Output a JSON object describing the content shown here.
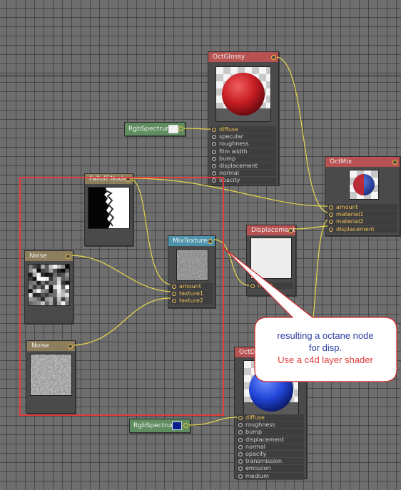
{
  "nodes": {
    "oct_glossy": {
      "title": "OctGlossy",
      "ports": [
        "diffuse",
        "specular",
        "roughness",
        "film width",
        "bump",
        "displacement",
        "normal",
        "opacity"
      ]
    },
    "oct_mix": {
      "title": "OctMix",
      "ports": [
        "amount",
        "material1",
        "material2",
        "displacement"
      ]
    },
    "falloff": {
      "title": "Falloff Node"
    },
    "mix_texture": {
      "title": "MixTexture",
      "ports": [
        "amount",
        "texture1",
        "texture2"
      ]
    },
    "displacement": {
      "title": "Displacement",
      "ports": [
        "input"
      ]
    },
    "noise_1": {
      "title": "Noise"
    },
    "noise_2": {
      "title": "Noise"
    },
    "oct_diffuse": {
      "title": "OctDiffuse",
      "ports": [
        "diffuse",
        "roughness",
        "bump",
        "displacement",
        "normal",
        "opacity",
        "transmission",
        "emission",
        "medium"
      ]
    },
    "rgb_1": {
      "title": "RgbSpectrum",
      "swatch": "#f2f2f2"
    },
    "rgb_2": {
      "title": "RgbSpectrum",
      "swatch": "#0a1e8c"
    }
  },
  "callout": {
    "line1": "resulting a octane node",
    "line2": "for disp.",
    "line3": "Use a c4d layer shader"
  },
  "colors": {
    "wire": "#e8d64a",
    "highlight_box": "#e43b3b",
    "callout_blue": "#2b3fa0",
    "callout_red": "#e23b3b"
  }
}
